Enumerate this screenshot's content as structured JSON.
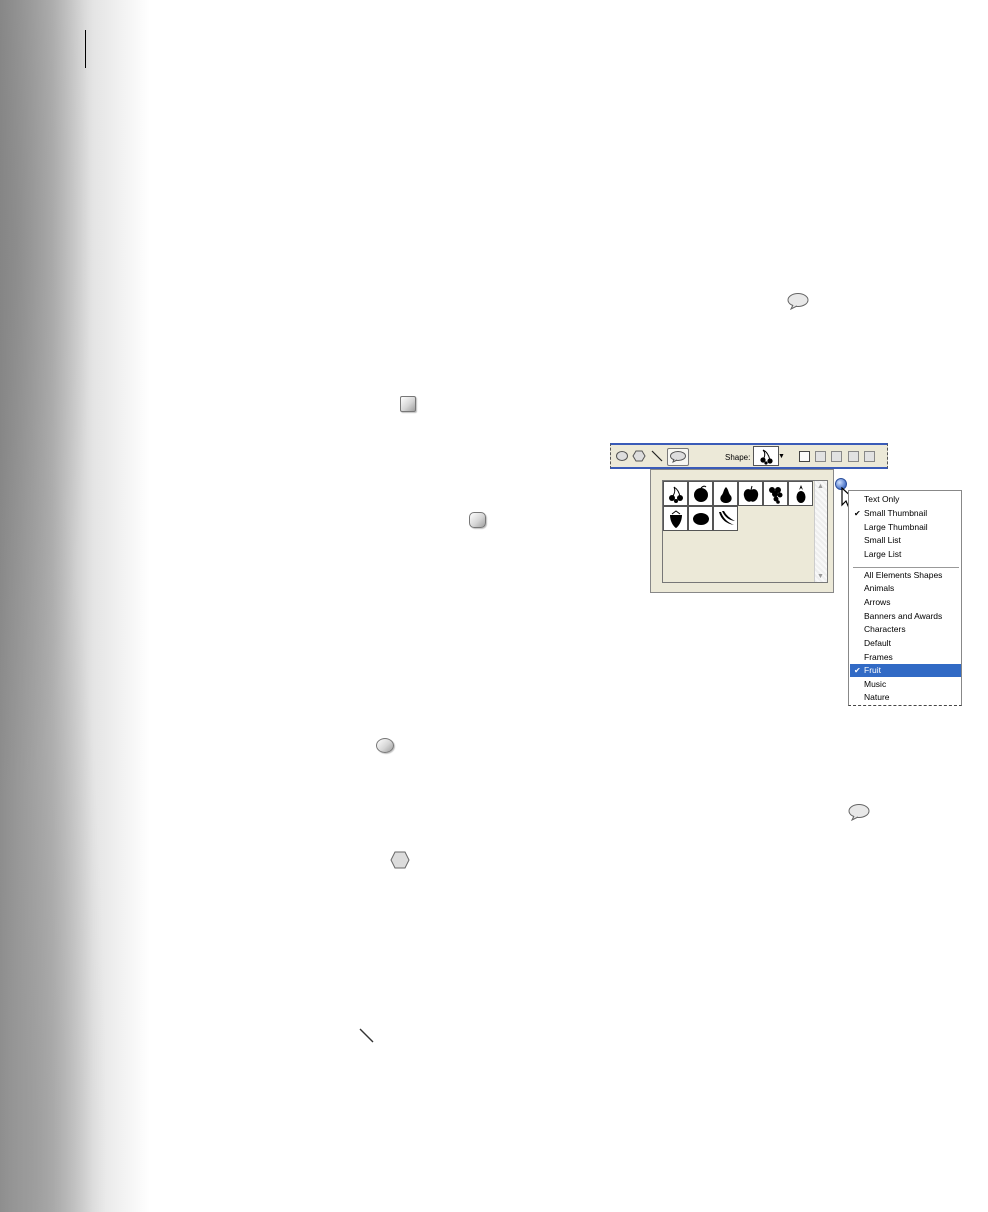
{
  "toolbar": {
    "shape_label": "Shape:",
    "tools": [
      {
        "name": "ellipse-tool-icon"
      },
      {
        "name": "polygon-tool-icon"
      },
      {
        "name": "line-tool-icon"
      },
      {
        "name": "custom-shape-tool-icon",
        "selected": true
      }
    ],
    "current_shape": "cherries-icon",
    "mode_buttons": [
      "create-new-shape-layer",
      "add-to-shape-area",
      "subtract-from-shape-area",
      "intersect-shape-areas",
      "exclude-overlapping-shape-areas"
    ]
  },
  "shape_picker": {
    "shapes": [
      "cherries",
      "orange",
      "pear",
      "apple",
      "grapes",
      "pineapple",
      "strawberry",
      "lemon",
      "bananas"
    ]
  },
  "popup_menu": {
    "view_options": [
      {
        "label": "Text Only",
        "checked": false
      },
      {
        "label": "Small Thumbnail",
        "checked": true
      },
      {
        "label": "Large Thumbnail",
        "checked": false
      },
      {
        "label": "Small List",
        "checked": false
      },
      {
        "label": "Large List",
        "checked": false
      }
    ],
    "libraries": [
      {
        "label": "All Elements Shapes",
        "checked": false
      },
      {
        "label": "Animals",
        "checked": false
      },
      {
        "label": "Arrows",
        "checked": false
      },
      {
        "label": "Banners and Awards",
        "checked": false
      },
      {
        "label": "Characters",
        "checked": false
      },
      {
        "label": "Default",
        "checked": false
      },
      {
        "label": "Frames",
        "checked": false
      },
      {
        "label": "Fruit",
        "checked": true,
        "highlighted": true
      },
      {
        "label": "Music",
        "checked": false
      },
      {
        "label": "Nature",
        "checked": false
      }
    ]
  },
  "colors": {
    "menu_highlight": "#316ac5",
    "toolbar_bg": "#ece9d8",
    "toolbar_border": "#3a5bb8"
  }
}
